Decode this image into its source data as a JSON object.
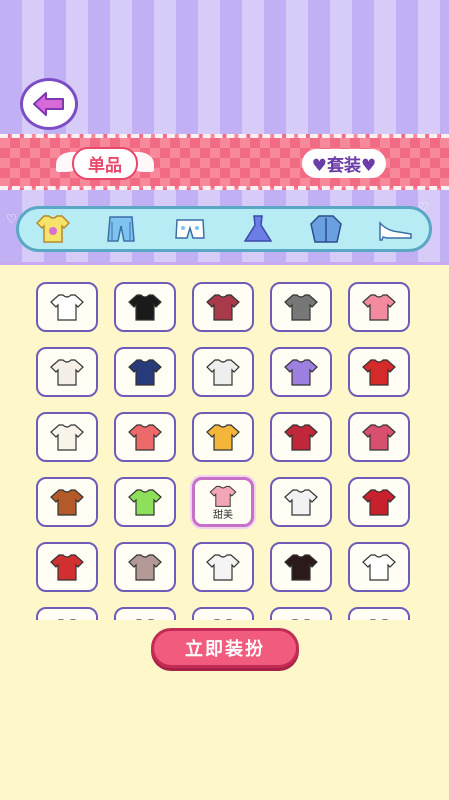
{
  "tabs": {
    "single": "单品",
    "set": "套装"
  },
  "categories": [
    "top-icon",
    "pants-icon",
    "shorts-icon",
    "dress-icon",
    "jacket-icon",
    "shoe-icon"
  ],
  "selected_category": 0,
  "items": [
    {
      "name": "white-crop-top",
      "color": "#ffffff"
    },
    {
      "name": "black-tank-top",
      "color": "#1a1a1a"
    },
    {
      "name": "striped-cami",
      "color": "#a83a4a"
    },
    {
      "name": "gray-striped-tank",
      "color": "#777777"
    },
    {
      "name": "pink-halter-top",
      "color": "#f48aa0"
    },
    {
      "name": "white-print-tank",
      "color": "#f4f0e8"
    },
    {
      "name": "navy-orange-polo",
      "color": "#273a7a"
    },
    {
      "name": "white-striped-shirt",
      "color": "#eeeeee"
    },
    {
      "name": "purple-ruffle-top",
      "color": "#9d7fe0"
    },
    {
      "name": "red-ruffle-cami",
      "color": "#d42a2a"
    },
    {
      "name": "white-lace-top",
      "color": "#f8f4ea"
    },
    {
      "name": "coral-tee",
      "color": "#ee6a6a"
    },
    {
      "name": "yellow-offshoulder-top",
      "color": "#f4b63a"
    },
    {
      "name": "red-striped-sweater",
      "color": "#c0283a"
    },
    {
      "name": "tie-dye-tee",
      "color": "#d9506e"
    },
    {
      "name": "brown-bandeau",
      "color": "#b45a2a"
    },
    {
      "name": "green-heart-crop",
      "color": "#8ee05a"
    },
    {
      "name": "pink-halter-sweet",
      "color": "#f2a6b6",
      "label": "甜美"
    },
    {
      "name": "white-tube-top",
      "color": "#f2f2f2"
    },
    {
      "name": "red-puff-crop",
      "color": "#c9202e"
    },
    {
      "name": "red-cardigan",
      "color": "#d23030"
    },
    {
      "name": "gray-print-tee",
      "color": "#b39a96"
    },
    {
      "name": "white-button-jacket",
      "color": "#f4f4f4"
    },
    {
      "name": "black-orange-cami",
      "color": "#2a1a1a"
    },
    {
      "name": "white-yellow-wrap",
      "color": "#ffffff"
    },
    {
      "name": "partial-item-1",
      "color": "#dddddd"
    },
    {
      "name": "partial-item-2",
      "color": "#eeeeee"
    },
    {
      "name": "partial-item-3",
      "color": "#eeeeee"
    },
    {
      "name": "partial-item-4",
      "color": "#5a2a2a"
    },
    {
      "name": "partial-item-5",
      "color": "#c07ab0"
    }
  ],
  "selected_item": 17,
  "action_button": "立即装扮",
  "colors": {
    "accent": "#f15b7e",
    "border": "#6f5bb8",
    "banner": "#f7899a",
    "stripe": "#c2b0f4"
  }
}
